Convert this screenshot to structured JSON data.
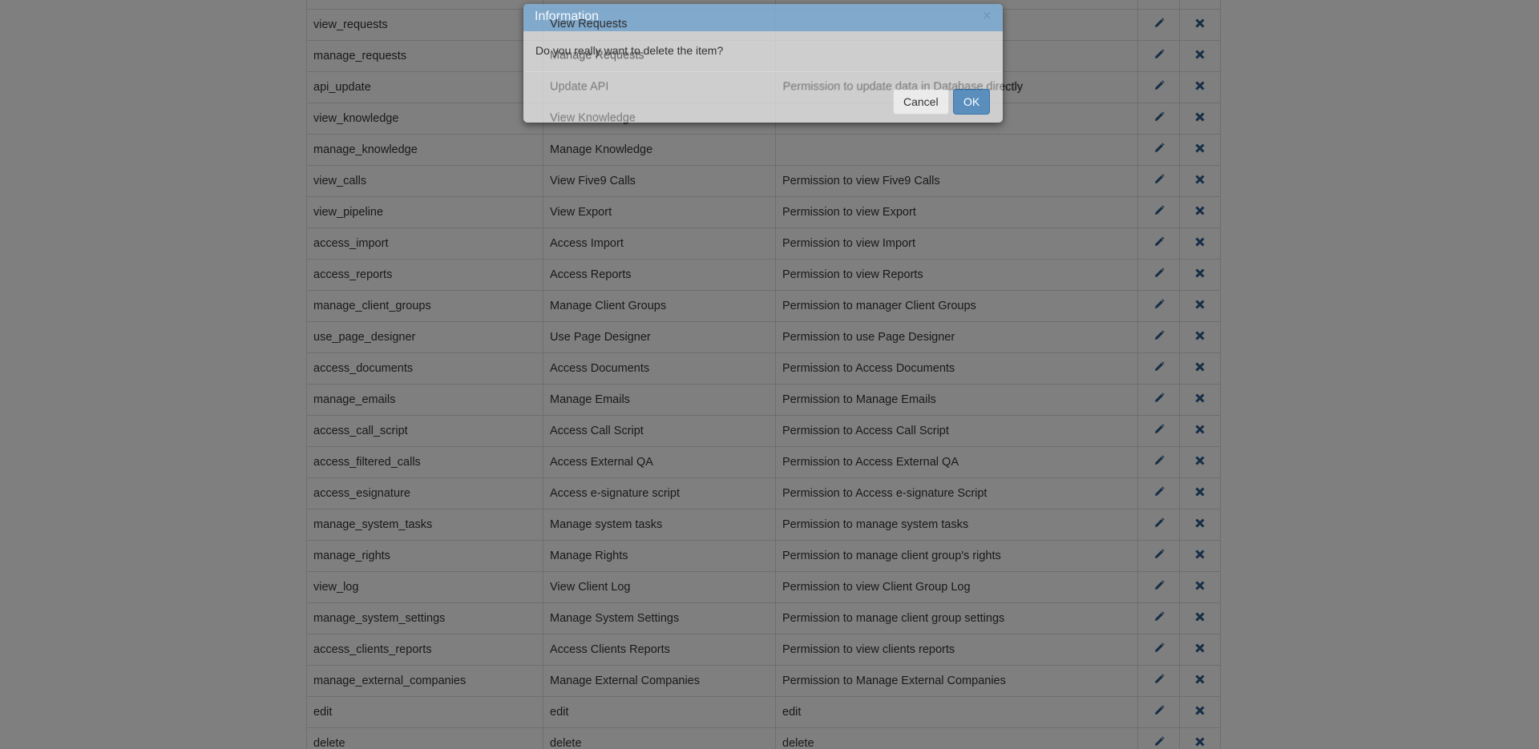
{
  "rights_table": {
    "rows": [
      {
        "name": "",
        "label": "",
        "description": ""
      },
      {
        "name": "view_requests",
        "label": "View Requests",
        "description": ""
      },
      {
        "name": "manage_requests",
        "label": "Manage Requests",
        "description": ""
      },
      {
        "name": "api_update",
        "label": "Update API",
        "description": "Permission to update data in Database directly"
      },
      {
        "name": "view_knowledge",
        "label": "View Knowledge",
        "description": ""
      },
      {
        "name": "manage_knowledge",
        "label": "Manage Knowledge",
        "description": ""
      },
      {
        "name": "view_calls",
        "label": "View Five9 Calls",
        "description": "Permission to view Five9 Calls"
      },
      {
        "name": "view_pipeline",
        "label": "View Export",
        "description": "Permission to view Export"
      },
      {
        "name": "access_import",
        "label": "Access Import",
        "description": "Permission to view Import"
      },
      {
        "name": "access_reports",
        "label": "Access Reports",
        "description": "Permission to view Reports"
      },
      {
        "name": "manage_client_groups",
        "label": "Manage Client Groups",
        "description": "Permission to manager Client Groups"
      },
      {
        "name": "use_page_designer",
        "label": "Use Page Designer",
        "description": "Permission to use Page Designer"
      },
      {
        "name": "access_documents",
        "label": "Access Documents",
        "description": "Permission to Access Documents"
      },
      {
        "name": "manage_emails",
        "label": "Manage Emails",
        "description": "Permission to Manage Emails"
      },
      {
        "name": "access_call_script",
        "label": "Access Call Script",
        "description": "Permission to Access Call Script"
      },
      {
        "name": "access_filtered_calls",
        "label": "Access External QA",
        "description": "Permission to Access External QA"
      },
      {
        "name": "access_esignature",
        "label": "Access e-signature script",
        "description": "Permission to Access e-signature Script"
      },
      {
        "name": "manage_system_tasks",
        "label": "Manage system tasks",
        "description": "Permission to manage system tasks"
      },
      {
        "name": "manage_rights",
        "label": "Manage Rights",
        "description": "Permission to manage client group's rights"
      },
      {
        "name": "view_log",
        "label": "View Client Log",
        "description": "Permission to view Client Group Log"
      },
      {
        "name": "manage_system_settings",
        "label": "Manage System Settings",
        "description": "Permission to manage client group settings"
      },
      {
        "name": "access_clients_reports",
        "label": "Access Clients Reports",
        "description": "Permission to view clients reports"
      },
      {
        "name": "manage_external_companies",
        "label": "Manage External Companies",
        "description": "Permission to Manage External Companies"
      },
      {
        "name": "edit",
        "label": "edit",
        "description": "edit"
      },
      {
        "name": "delete",
        "label": "delete",
        "description": "delete"
      }
    ],
    "edit_icon": "pencil-icon",
    "delete_icon": "remove-icon",
    "icon_color": "#2a5a8a"
  },
  "dialog": {
    "title": "Information",
    "close_symbol": "×",
    "message": "Do you really want to delete the item?",
    "cancel_label": "Cancel",
    "ok_label": "OK",
    "header_color": "#5b8cbf",
    "ok_color": "#4d7fb0"
  }
}
